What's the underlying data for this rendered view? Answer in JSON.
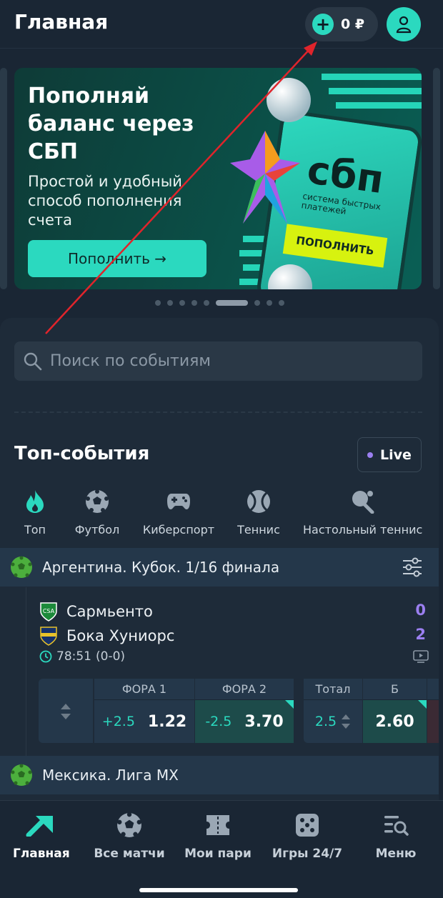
{
  "header": {
    "title": "Главная",
    "balance": "0 ₽"
  },
  "banner": {
    "title": "Пополняй баланс через СБП",
    "subtitle": "Простой и удобный способ пополнения счета",
    "button": "Пополнить →",
    "sbp_logo": "сбп",
    "sbp_caption": "система быстрых платежей",
    "phone_button": "ПОПОЛНИТЬ",
    "slide_count": 9,
    "active_slide": 6
  },
  "search": {
    "placeholder": "Поиск по событиям"
  },
  "top_events": {
    "title": "Топ-события",
    "live_label": "Live",
    "sports": [
      {
        "label": "Топ",
        "icon": "flame-icon"
      },
      {
        "label": "Футбол",
        "icon": "soccer-ball-icon"
      },
      {
        "label": "Киберспорт",
        "icon": "gamepad-icon"
      },
      {
        "label": "Теннис",
        "icon": "tennis-ball-icon"
      },
      {
        "label": "Настольный теннис",
        "icon": "table-tennis-icon"
      }
    ]
  },
  "leagues": [
    {
      "name": "Аргентина. Кубок. 1/16 финала",
      "match": {
        "team1": "Сармьенто",
        "score1": "0",
        "team2": "Бока Хуниорс",
        "score2": "2",
        "time": "78:51",
        "period_score": "(0-0)",
        "odds": {
          "fora1_header": "ФОРА 1",
          "fora1_hcp": "+2.5",
          "fora1_coef": "1.22",
          "fora2_header": "ФОРА 2",
          "fora2_hcp": "-2.5",
          "fora2_coef": "3.70",
          "total_header": "Тотал",
          "total_value": "2.5",
          "over_header": "Б",
          "over_coef": "2.60"
        }
      }
    },
    {
      "name": "Мексика. Лига MX"
    }
  ],
  "bottom_nav": [
    {
      "label": "Главная",
      "icon": "home-arrow-icon",
      "active": true
    },
    {
      "label": "Все матчи",
      "icon": "soccer-ball-icon"
    },
    {
      "label": "Мои пари",
      "icon": "ticket-icon"
    },
    {
      "label": "Игры 24/7",
      "icon": "dice-icon"
    },
    {
      "label": "Меню",
      "icon": "menu-search-icon"
    }
  ],
  "colors": {
    "accent": "#2bd9bf",
    "background": "#1a2634",
    "live": "#9b7ff0",
    "annotation_arrow": "#e0242b"
  }
}
